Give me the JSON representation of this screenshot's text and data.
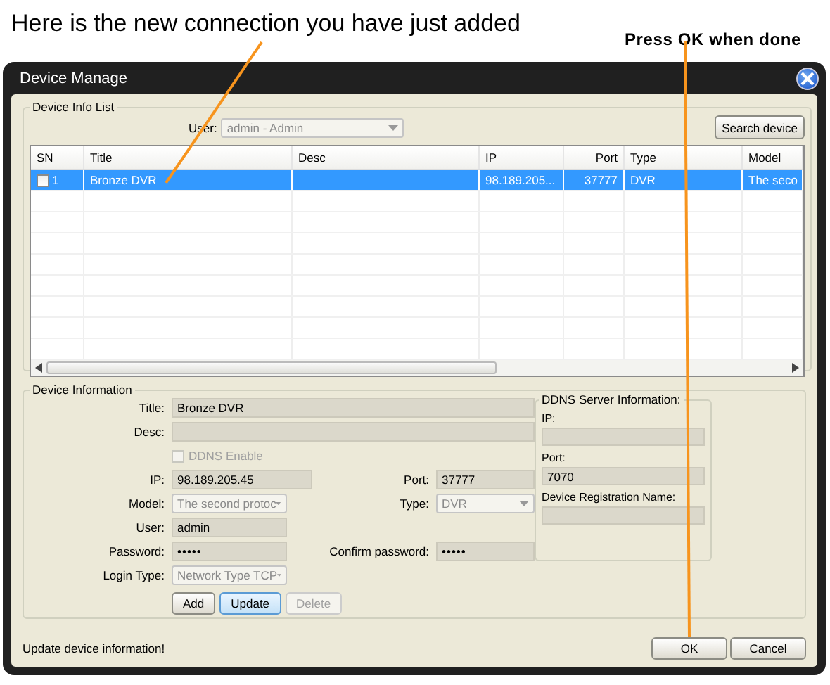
{
  "callouts": [
    {
      "text": "Here is the new connection you have just added"
    },
    {
      "text": "Press OK when done"
    }
  ],
  "window": {
    "title": "Device Manage"
  },
  "device_info_list": {
    "title": "Device Info List",
    "user_label": "User:",
    "user_value": "admin - Admin",
    "search_button": "Search device",
    "columns": [
      "SN",
      "Title",
      "Desc",
      "IP",
      "Port",
      "Type",
      "Model"
    ],
    "rows": [
      {
        "checked": false,
        "selected": true,
        "cells": [
          "1",
          "Bronze DVR",
          "",
          "98.189.205...",
          "37777",
          "DVR",
          "The seco"
        ]
      }
    ]
  },
  "device_information": {
    "title": "Device Information",
    "title_field": {
      "label": "Title:",
      "value": "Bronze DVR"
    },
    "desc_field": {
      "label": "Desc:"
    },
    "ddns_enable": {
      "label": "DDNS Enable",
      "checked": false,
      "disabled": true
    },
    "ip_field": {
      "label": "IP:",
      "value": "98.189.205.45"
    },
    "port_field": {
      "label": "Port:",
      "value": "37777"
    },
    "model_field": {
      "label": "Model:",
      "value": "The second protoc",
      "disabled": true
    },
    "type_field": {
      "label": "Type:",
      "value": "DVR",
      "disabled": true
    },
    "user_field": {
      "label": "User:",
      "value": "admin"
    },
    "password_field": {
      "label": "Password:",
      "value": "•••••"
    },
    "confirm_field": {
      "label": "Confirm password:",
      "value": "•••••"
    },
    "login_type_field": {
      "label": "Login Type:",
      "value": "Network Type TCP",
      "disabled": true
    },
    "buttons": [
      {
        "label": "Add",
        "focused": false,
        "disabled": false
      },
      {
        "label": "Update",
        "focused": true,
        "disabled": false
      },
      {
        "label": "Delete",
        "focused": false,
        "disabled": true
      }
    ],
    "ddns": {
      "title": "DDNS Server Information:",
      "ip_label": "IP:",
      "port_label": "Port:",
      "port_value": "7070",
      "reg_label": "Device Registration Name:"
    }
  },
  "status_bar": {
    "text": "Update device information!"
  },
  "dialog_buttons": [
    "OK",
    "Cancel"
  ]
}
